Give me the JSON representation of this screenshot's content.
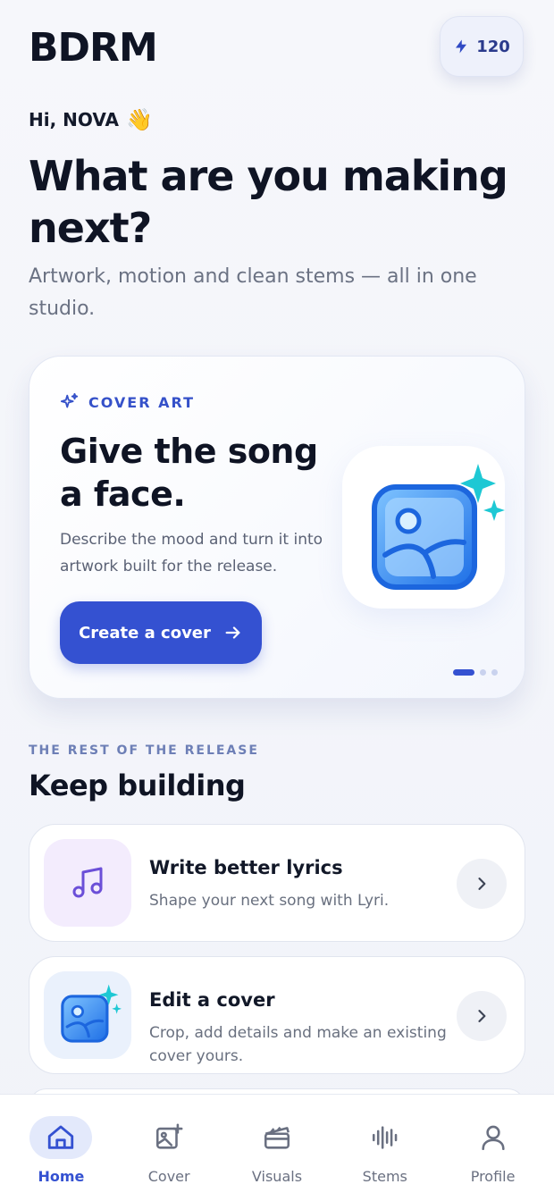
{
  "header": {
    "logo": "BDRM",
    "credits": "120",
    "greeting": "Hi, NOVA",
    "wave_emoji": "👋",
    "headline": "What are you making next?",
    "subtitle": "Artwork, motion and clean stems — all in one studio."
  },
  "hero": {
    "kicker": "COVER ART",
    "title": "Give the song a face.",
    "description": "Describe the mood and turn it into artwork built for the release.",
    "cta": "Create a cover",
    "carousel_index": 1,
    "carousel_count": 3
  },
  "section": {
    "kicker": "THE REST OF THE RELEASE",
    "title": "Keep building"
  },
  "cards": [
    {
      "title": "Write better lyrics",
      "description": "Shape your next song with Lyri.",
      "icon": "music-note-icon"
    },
    {
      "title": "Edit a cover",
      "description": "Crop, add details and make an existing cover yours.",
      "icon": "glossy-image-icon"
    }
  ],
  "tabs": [
    {
      "label": "Home",
      "icon": "home-icon",
      "active": true
    },
    {
      "label": "Cover",
      "icon": "image-plus-icon",
      "active": false
    },
    {
      "label": "Visuals",
      "icon": "clapperboard-icon",
      "active": false
    },
    {
      "label": "Stems",
      "icon": "waveform-icon",
      "active": false
    },
    {
      "label": "Profile",
      "icon": "user-icon",
      "active": false
    }
  ],
  "colors": {
    "accent": "#3451d1",
    "kicker": "#3551c9",
    "text": "#0f1424",
    "muted": "#6b7283",
    "sparkle": "#1ec8d4"
  }
}
